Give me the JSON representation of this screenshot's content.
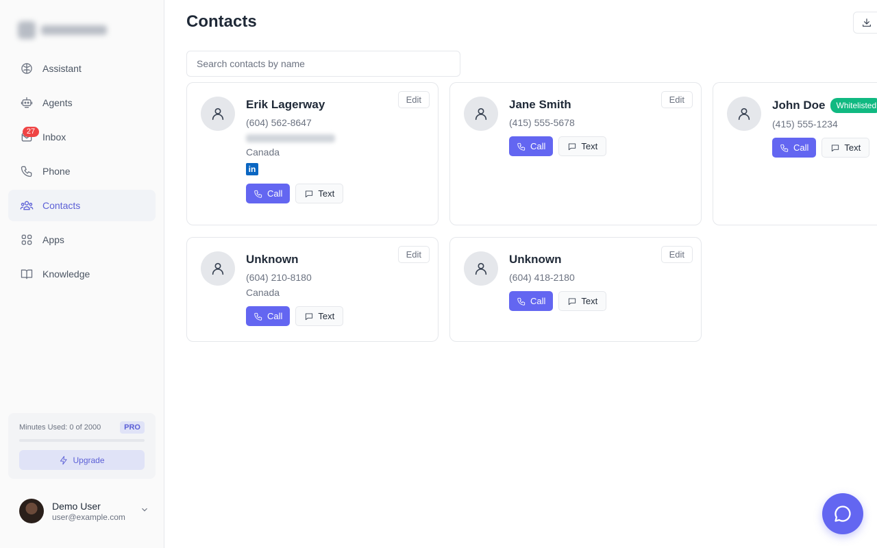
{
  "sidebar": {
    "items": [
      {
        "label": "Assistant",
        "icon": "brain-icon"
      },
      {
        "label": "Agents",
        "icon": "robot-icon"
      },
      {
        "label": "Inbox",
        "icon": "mail-icon",
        "badge": "27"
      },
      {
        "label": "Phone",
        "icon": "phone-icon"
      },
      {
        "label": "Contacts",
        "icon": "users-icon",
        "active": true
      },
      {
        "label": "Apps",
        "icon": "grid-icon"
      },
      {
        "label": "Knowledge",
        "icon": "book-icon"
      }
    ],
    "usage": {
      "text": "Minutes Used: 0 of 2000",
      "plan": "PRO",
      "upgrade_label": "Upgrade",
      "progress": 0
    },
    "user": {
      "name": "Demo User",
      "email": "user@example.com"
    }
  },
  "main": {
    "title": "Contacts",
    "search_placeholder": "Search contacts by name"
  },
  "labels": {
    "call": "Call",
    "text": "Text",
    "edit": "Edit"
  },
  "contacts": [
    {
      "name": "Erik Lagerway",
      "phone": "(604) 562-8647",
      "location": "Canada",
      "linkedin": true,
      "email_redacted": true
    },
    {
      "name": "Jane Smith",
      "phone": "(415) 555-5678"
    },
    {
      "name": "John Doe",
      "phone": "(415) 555-1234",
      "tag": "Whitelisted"
    },
    {
      "name": "Unknown",
      "phone": "(604) 210-8180",
      "location": "Canada"
    },
    {
      "name": "Unknown",
      "phone": "(604) 418-2180"
    }
  ],
  "colors": {
    "accent": "#6366f1",
    "whitelisted": "#10b981",
    "badge": "#ef4444",
    "linkedin": "#0a66c2"
  }
}
